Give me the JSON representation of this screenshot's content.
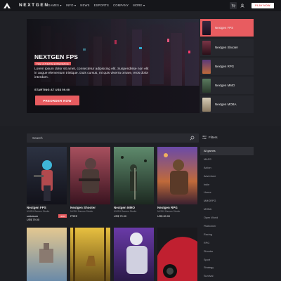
{
  "nav": {
    "brand": "NEXTGEN",
    "links": [
      "GAMES ▾",
      "INFO ▾",
      "NEWS",
      "ESPORTS",
      "COMPANY",
      "MORE ▾"
    ],
    "play_label": "PLAY NOW",
    "cart_icon": "cart-icon",
    "user_icon": "user-icon"
  },
  "hero": {
    "title": "NEXTGEN FPS",
    "tag": "THE ULTIMATE EXPERIENCE",
    "description": "Lorem ipsum dolor sit amet, consectetur adipiscing elit. Suspendisse non elit in augue elementum tristique. Duis cursus, mi quis viverra ornare, eros dolor interdum.",
    "price": "STARTING AT US$ 59.00",
    "button": "PREORDER NOW",
    "list": [
      {
        "label": "Nextgen FPS",
        "active": true
      },
      {
        "label": "Nextgen Shooter",
        "active": false
      },
      {
        "label": "Nextgen RPG",
        "active": false
      },
      {
        "label": "Nextgen MMO",
        "active": false
      },
      {
        "label": "Nextgen MOBA",
        "active": false
      }
    ]
  },
  "search": {
    "placeholder": "Search"
  },
  "filters": {
    "title": "Filters",
    "items": [
      "All games",
      "MASS",
      "Action",
      "Adventure",
      "Indie",
      "Horror",
      "MMORPG",
      "MOBA",
      "Open World",
      "Platformer",
      "Racing",
      "RPG",
      "Shooter",
      "Sport",
      "Strategy",
      "Survival"
    ]
  },
  "cards": [
    {
      "title": "Nextgen FPS",
      "studio": "NXGN Games Studio",
      "old_price": "US$ 99.00",
      "price": "US$ 79.00",
      "badge": "-20%"
    },
    {
      "title": "Nextgen Shooter",
      "studio": "NXGN Games Studio",
      "old_price": "",
      "price": "FREE",
      "badge": ""
    },
    {
      "title": "Nextgen MMO",
      "studio": "NXGN Games Studio",
      "old_price": "",
      "price": "US$ 79.00",
      "badge": ""
    },
    {
      "title": "Nextgen RPG",
      "studio": "NXGN Games Studio",
      "old_price": "",
      "price": "US$ 69.00",
      "badge": ""
    }
  ],
  "colors": {
    "accent": "#e85c60",
    "background": "#1e1f24",
    "surface": "#2a2b31"
  }
}
